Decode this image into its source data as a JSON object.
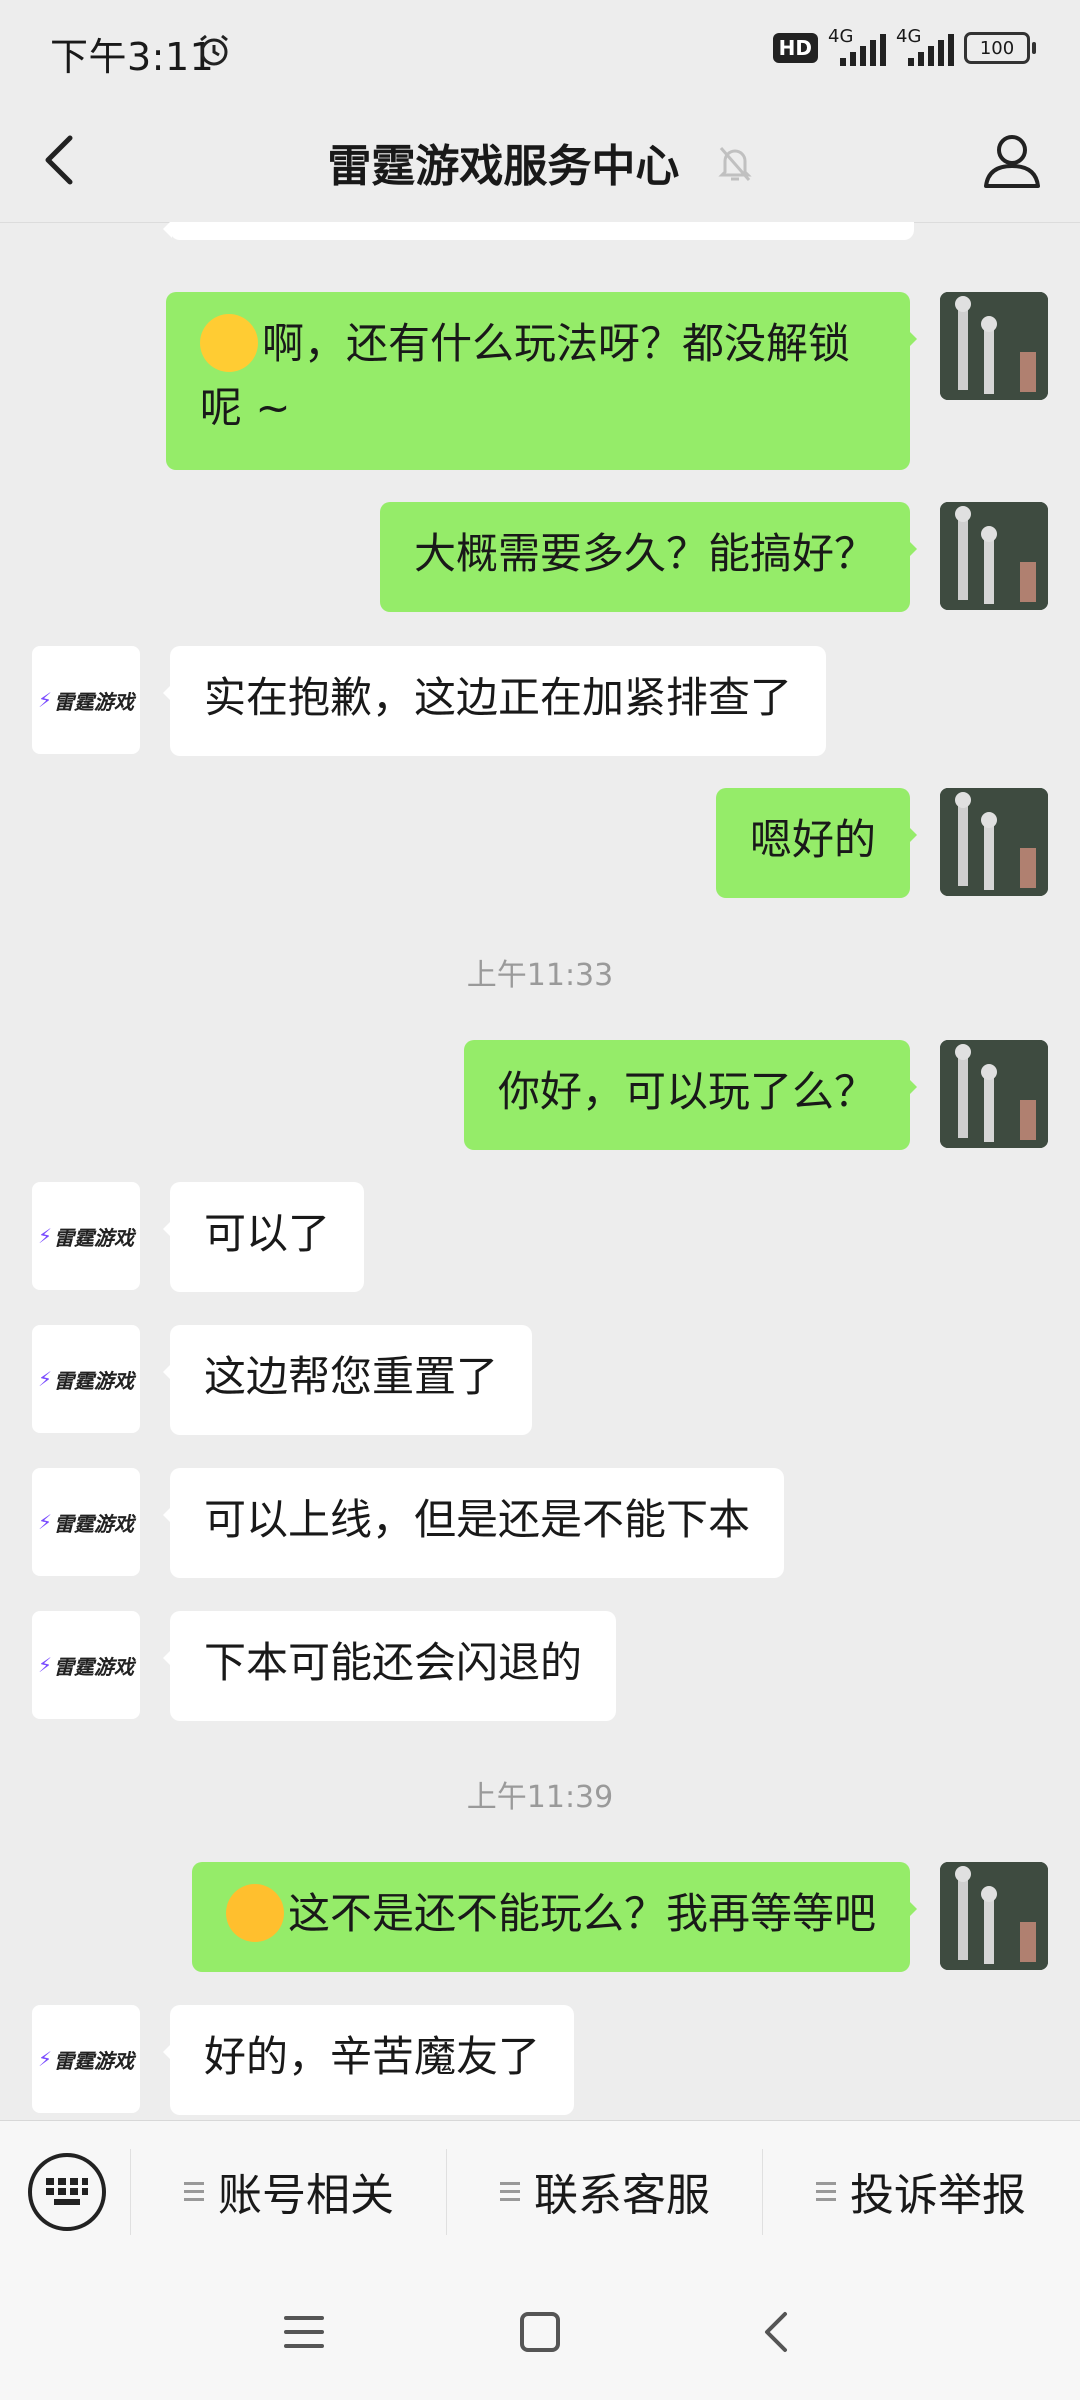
{
  "status_bar": {
    "time": "下午3:11",
    "hd_label": "HD",
    "net1": "4G",
    "net2": "4G",
    "battery": "100"
  },
  "header": {
    "title": "雷霆游戏服务中心"
  },
  "service": {
    "logo_text": "雷霆游戏"
  },
  "messages": [
    {
      "from": "me",
      "text": "啊，还有什么玩法呀？都没解锁呢 ~",
      "emoji": "thinking-face"
    },
    {
      "from": "me",
      "text": "大概需要多久？能搞好？"
    },
    {
      "from": "service",
      "text": "实在抱歉，这边正在加紧排查了"
    },
    {
      "from": "me",
      "text": "嗯好的"
    },
    {
      "type": "time",
      "text": "上午11:33"
    },
    {
      "from": "me",
      "text": "你好，可以玩了么？"
    },
    {
      "from": "service",
      "text": "可以了"
    },
    {
      "from": "service",
      "text": "这边帮您重置了"
    },
    {
      "from": "service",
      "text": "可以上线，但是还是不能下本"
    },
    {
      "from": "service",
      "text": "下本可能还会闪退的"
    },
    {
      "type": "time",
      "text": "上午11:39"
    },
    {
      "from": "me",
      "text": "这不是还不能玩么？我再等等吧",
      "emoji": "crying-face"
    },
    {
      "from": "service",
      "text": "好的，辛苦魔友了"
    }
  ],
  "bottom_menu": {
    "items": [
      "账号相关",
      "联系客服",
      "投诉举报"
    ]
  },
  "colors": {
    "my_bubble": "#95ec69",
    "service_bubble": "#ffffff",
    "background": "#ededed"
  }
}
